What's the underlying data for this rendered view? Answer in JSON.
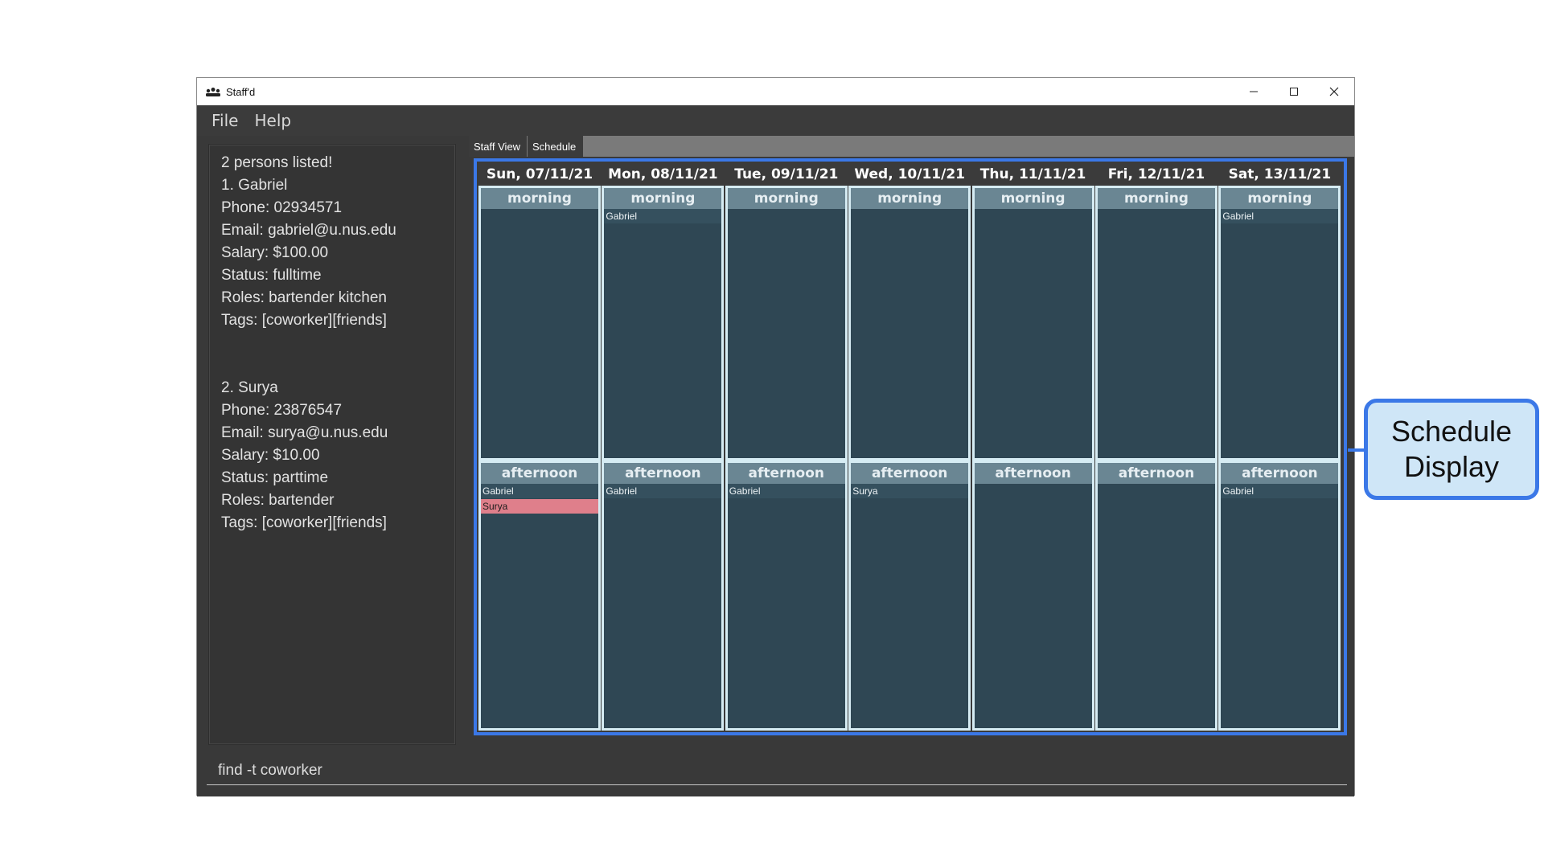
{
  "window": {
    "title": "Staff'd"
  },
  "menu": {
    "items": [
      "File",
      "Help"
    ]
  },
  "result": {
    "status": "2 persons listed!"
  },
  "persons": [
    {
      "lines": [
        "1. Gabriel",
        "Phone: 02934571",
        "Email: gabriel@u.nus.edu",
        "Salary: $100.00",
        "Status: fulltime",
        "Roles: bartender kitchen",
        "Tags: [coworker][friends]"
      ]
    },
    {
      "lines": [
        "2. Surya",
        "Phone: 23876547",
        "Email: surya@u.nus.edu",
        "Salary: $10.00",
        "Status: parttime",
        "Roles: bartender",
        "Tags: [coworker][friends]"
      ]
    }
  ],
  "tabs": {
    "staff_view": "Staff View",
    "schedule": "Schedule"
  },
  "schedule": {
    "days": [
      {
        "date": "Sun, 07/11/21",
        "morning": [],
        "afternoon": [
          "Gabriel",
          "Surya"
        ]
      },
      {
        "date": "Mon, 08/11/21",
        "morning": [
          "Gabriel"
        ],
        "afternoon": [
          "Gabriel"
        ]
      },
      {
        "date": "Tue, 09/11/21",
        "morning": [],
        "afternoon": [
          "Gabriel"
        ]
      },
      {
        "date": "Wed, 10/11/21",
        "morning": [],
        "afternoon": [
          "Surya"
        ]
      },
      {
        "date": "Thu, 11/11/21",
        "morning": [],
        "afternoon": []
      },
      {
        "date": "Fri, 12/11/21",
        "morning": [],
        "afternoon": []
      },
      {
        "date": "Sat, 13/11/21",
        "morning": [
          "Gabriel"
        ],
        "afternoon": [
          "Gabriel"
        ]
      }
    ],
    "morning_label": "morning",
    "afternoon_label": "afternoon",
    "highlighted_entry": "Surya",
    "highlight_color": "#df7f8b"
  },
  "command": {
    "value": "find -t coworker"
  },
  "callout": {
    "line1": "Schedule",
    "line2": "Display"
  },
  "colors": {
    "accent": "#3b78e7",
    "shift_bg": "#2f4754",
    "shift_label_bg": "#6a8693"
  }
}
